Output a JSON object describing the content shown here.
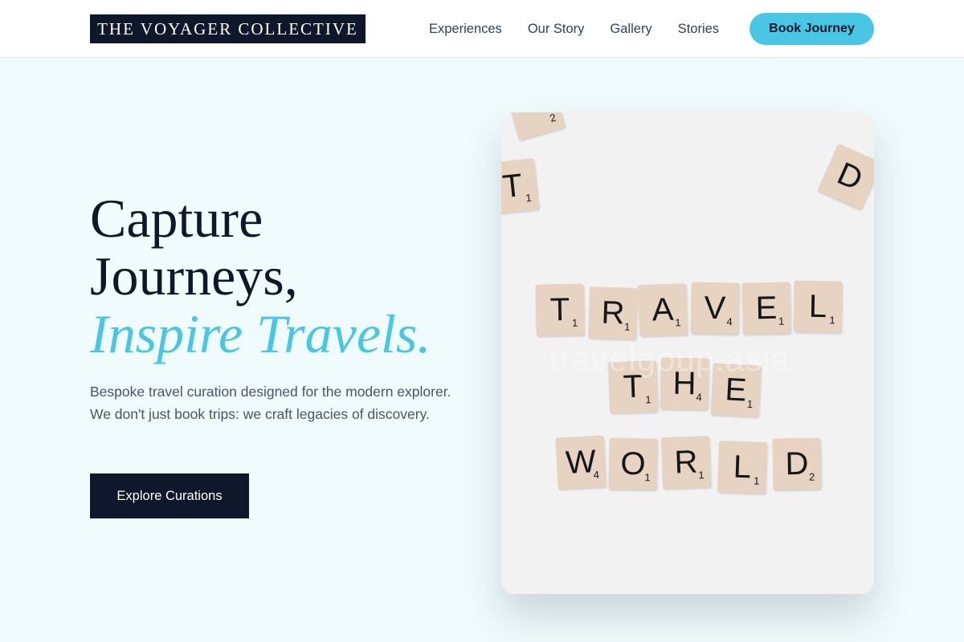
{
  "brand": {
    "name": "THE VOYAGER COLLECTIVE"
  },
  "nav": {
    "links": [
      "Experiences",
      "Our Story",
      "Gallery",
      "Stories"
    ],
    "cta": "Book Journey"
  },
  "hero": {
    "line1": "Capture",
    "line2": "Journeys,",
    "line3": "Inspire Travels.",
    "description": "Bespoke travel curation designed for the modern explorer. We don't just book trips: we craft legacies of discovery.",
    "cta": "Explore Curations"
  },
  "image": {
    "words": [
      "TRAVEL",
      "THE",
      "WORLD"
    ],
    "tiles": [
      {
        "letter": "T",
        "value": "1"
      },
      {
        "letter": "R",
        "value": "1"
      },
      {
        "letter": "A",
        "value": "1"
      },
      {
        "letter": "V",
        "value": "4"
      },
      {
        "letter": "E",
        "value": "1"
      },
      {
        "letter": "L",
        "value": "1"
      },
      {
        "letter": "T",
        "value": "1"
      },
      {
        "letter": "H",
        "value": "4"
      },
      {
        "letter": "E",
        "value": "1"
      },
      {
        "letter": "W",
        "value": "4"
      },
      {
        "letter": "O",
        "value": "1"
      },
      {
        "letter": "R",
        "value": "1"
      },
      {
        "letter": "L",
        "value": "1"
      },
      {
        "letter": "D",
        "value": "2"
      },
      {
        "letter": "T",
        "value": "1"
      },
      {
        "letter": "D",
        "value": ""
      },
      {
        "letter": "",
        "value": "2"
      }
    ],
    "watermark": "travelgoup.asia"
  },
  "colors": {
    "navy": "#0f172a",
    "accent": "#48c6e4",
    "background": "#f0fbfd",
    "tile": "#e6d3c2"
  }
}
